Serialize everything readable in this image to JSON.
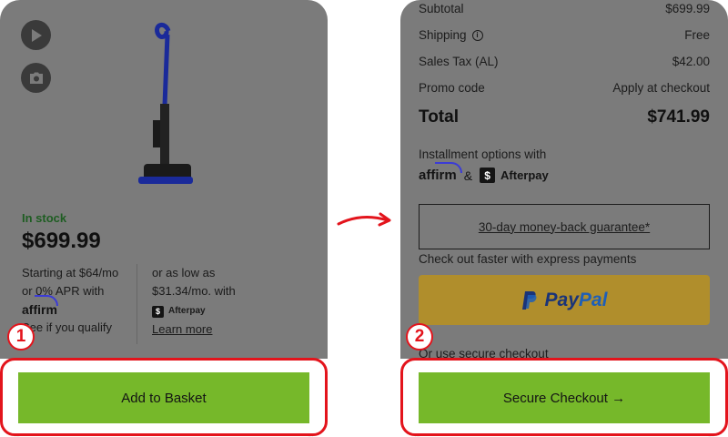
{
  "product": {
    "stock_status": "In stock",
    "price": "$699.99",
    "financing": {
      "affirm_line1": "Starting at $64/mo",
      "affirm_line2": "or 0% APR with",
      "affirm_brand": "affirm",
      "affirm_line3": "See if you qualify",
      "afterpay_line1": "or as low as",
      "afterpay_line2": "$31.34/mo. with",
      "afterpay_brand": "Afterpay",
      "learn_more": "Learn more"
    },
    "add_to_basket": "Add to Basket"
  },
  "order_summary": {
    "subtotal_label": "Subtotal",
    "subtotal_value": "$699.99",
    "shipping_label": "Shipping",
    "shipping_value": "Free",
    "tax_label": "Sales Tax (AL)",
    "tax_value": "$42.00",
    "promo_label": "Promo code",
    "promo_value": "Apply at checkout",
    "total_label": "Total",
    "total_value": "$741.99"
  },
  "installments": {
    "title": "Installment options with",
    "affirm_brand": "affirm",
    "ampersand": "&",
    "afterpay_brand": "Afterpay"
  },
  "guarantee": "30-day money-back guarantee*",
  "express": {
    "title": "Check out faster with express payments",
    "paypal_pay": "Pay",
    "paypal_pal": "Pal"
  },
  "secure_alt": "Or use secure checkout",
  "checkout_button": "Secure Checkout →",
  "steps": {
    "step1": "1",
    "step2": "2"
  },
  "colors": {
    "overlay": "#7b7b7b",
    "button_green": "#76b82a",
    "highlight_red": "#e3141c",
    "paypal_yellow": "#b08e2c",
    "stock_green": "#1e5d22"
  },
  "icons": {
    "play": "play-icon",
    "camera": "camera-icon",
    "info": "info-icon",
    "arrow": "curved-arrow-icon"
  }
}
